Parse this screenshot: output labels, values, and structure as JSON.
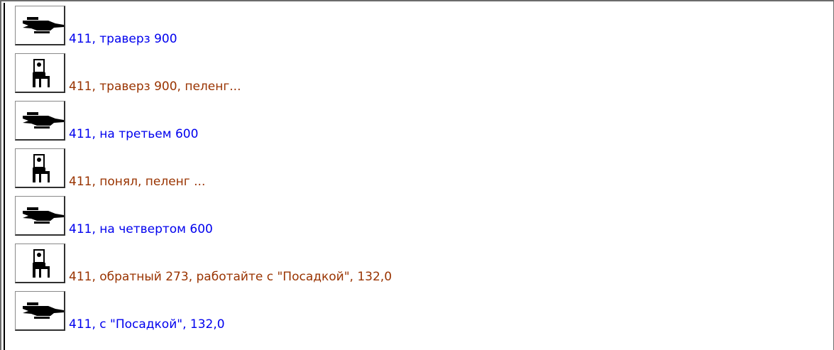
{
  "colors": {
    "pilot": "#0000ee",
    "controller": "#993300"
  },
  "messages": [
    {
      "speaker": "pilot",
      "icon": "airplane-icon",
      "text": "411, траверз 900"
    },
    {
      "speaker": "controller",
      "icon": "controller-icon",
      "text": "411, траверз 900, пеленг..."
    },
    {
      "speaker": "pilot",
      "icon": "airplane-icon",
      "text": "411, на третьем 600"
    },
    {
      "speaker": "controller",
      "icon": "controller-icon",
      "text": "411, понял, пеленг ..."
    },
    {
      "speaker": "pilot",
      "icon": "airplane-icon",
      "text": "411, на четвертом 600"
    },
    {
      "speaker": "controller",
      "icon": "controller-icon",
      "text": "411, обратный 273, работайте с \"Посадкой\", 132,0"
    },
    {
      "speaker": "pilot",
      "icon": "airplane-icon",
      "text": "411, с \"Посадкой\", 132,0"
    }
  ]
}
